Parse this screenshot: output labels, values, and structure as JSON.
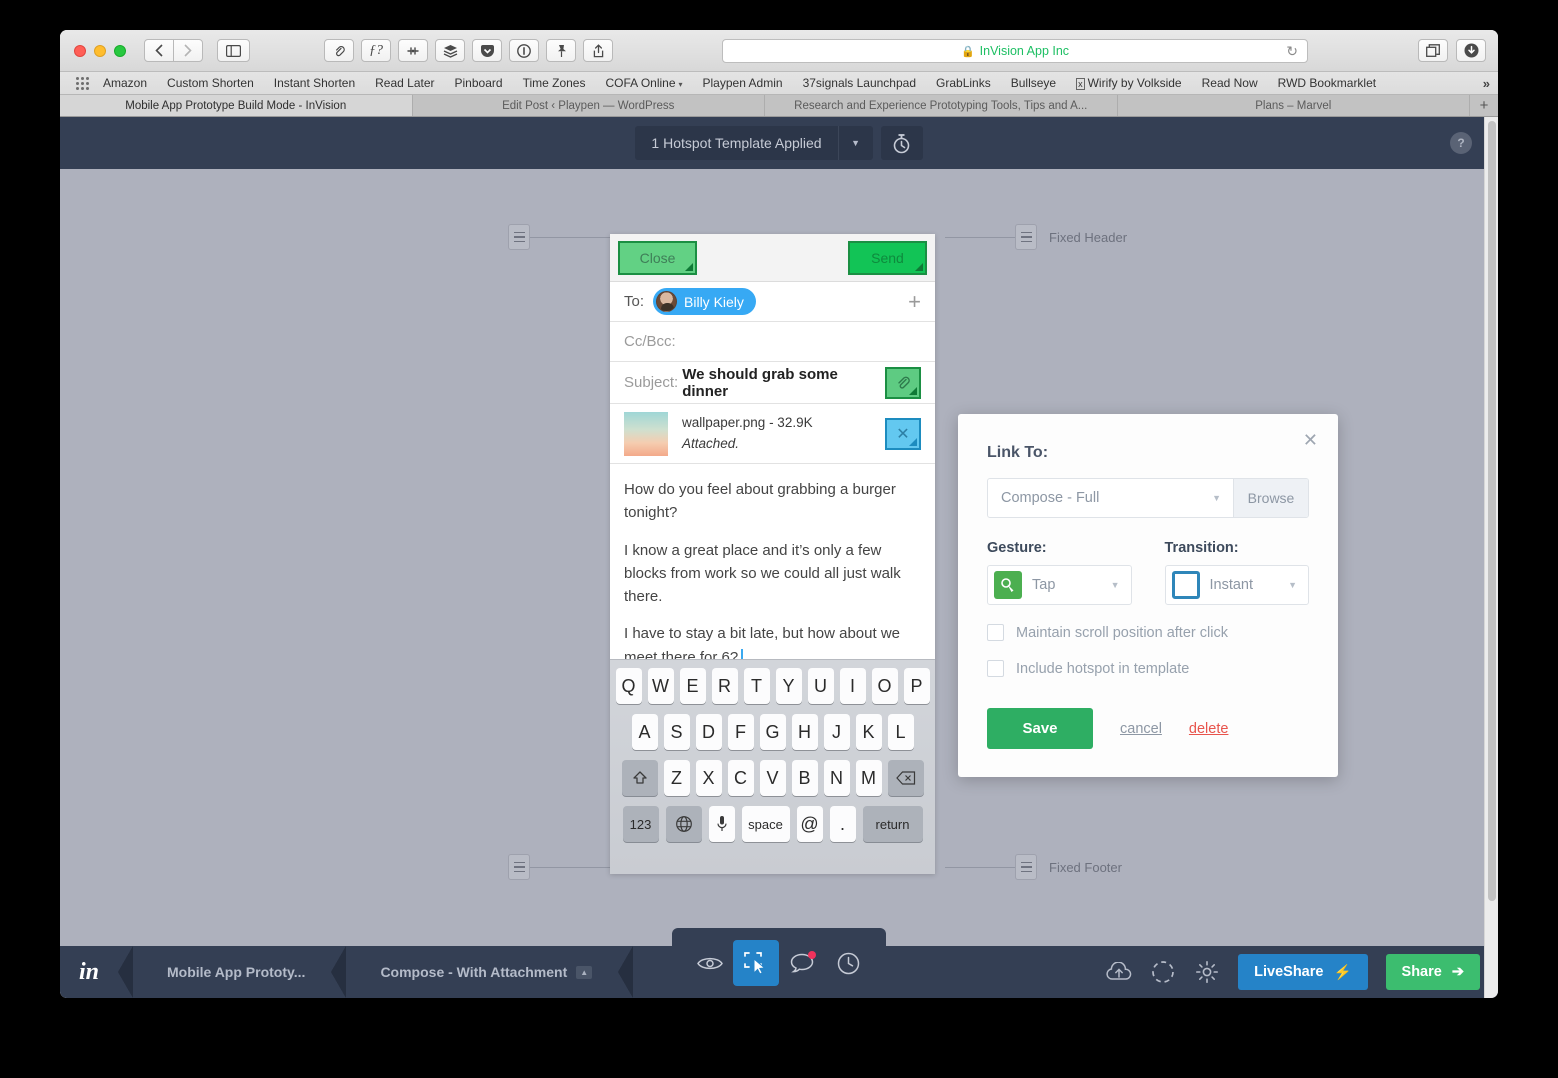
{
  "browser": {
    "url": {
      "site": "InVision App Inc",
      "lock": "lock-icon",
      "reload": "↻"
    },
    "toolbar_icons": [
      "link-icon",
      "function-icon",
      "sparkle-icon",
      "layers-icon",
      "pocket-icon",
      "instapaper-icon",
      "pin-icon",
      "share-icon"
    ],
    "right_icons": [
      "tabs-overview-icon",
      "downloads-icon"
    ],
    "nav": {
      "back": "‹",
      "forward": "›",
      "sidebar": "▣"
    },
    "bookmarks": [
      {
        "label": "Amazon"
      },
      {
        "label": "Custom Shorten"
      },
      {
        "label": "Instant Shorten"
      },
      {
        "label": "Read Later"
      },
      {
        "label": "Pinboard"
      },
      {
        "label": "Time Zones"
      },
      {
        "label": "COFA Online",
        "caret": "▾"
      },
      {
        "label": "Playpen Admin"
      },
      {
        "label": "37signals Launchpad"
      },
      {
        "label": "GrabLinks"
      },
      {
        "label": "Bullseye"
      },
      {
        "label": "Wirify by Volkside",
        "icon": "x-box-icon"
      },
      {
        "label": "Read Now"
      },
      {
        "label": "RWD Bookmarklet"
      }
    ],
    "bookmarks_more": "»",
    "tabs": [
      {
        "label": "Mobile App Prototype Build Mode - InVision",
        "active": true
      },
      {
        "label": "Edit Post ‹ Playpen — WordPress",
        "active": false
      },
      {
        "label": "Research and Experience Prototyping Tools, Tips and A...",
        "active": false
      },
      {
        "label": "Plans – Marvel",
        "active": false
      }
    ],
    "tab_add": "+"
  },
  "app": {
    "top": {
      "hotspot_template_label": "1 Hotspot Template Applied",
      "dropdown_caret": "▼",
      "timer_icon": "stopwatch-icon",
      "help_label": "?"
    },
    "canvas": {
      "fixed_header_label": "Fixed Header",
      "fixed_footer_label": "Fixed Footer"
    },
    "bottom": {
      "logo": "in",
      "breadcrumb": [
        {
          "label": "Mobile App Prototy..."
        },
        {
          "label": "Compose - With Attachment",
          "badge": "▲"
        }
      ],
      "tools": [
        {
          "name": "preview-icon",
          "active": false,
          "badge": false
        },
        {
          "name": "build-hotspot-icon",
          "active": true,
          "badge": false
        },
        {
          "name": "comment-icon",
          "active": false,
          "badge": true
        },
        {
          "name": "history-icon",
          "active": false,
          "badge": false
        }
      ],
      "right_icons": [
        "upload-cloud-icon",
        "sync-circle-icon",
        "gear-icon"
      ],
      "liveshare_label": "LiveShare",
      "liveshare_icon": "⚡",
      "share_label": "Share",
      "share_icon": "➔"
    }
  },
  "screen": {
    "header": {
      "close_label": "Close",
      "send_label": "Send"
    },
    "to": {
      "label": "To:",
      "recipient": "Billy Kiely",
      "add": "+"
    },
    "cc": {
      "label": "Cc/Bcc:"
    },
    "subject": {
      "label": "Subject:",
      "value": "We should grab some dinner",
      "clip_icon": "paperclip-icon"
    },
    "attachment": {
      "name": "wallpaper.png - 32.9K",
      "status": "Attached.",
      "remove_icon": "✕"
    },
    "body": [
      "How do you feel about grabbing a burger tonight?",
      "I know a great place and it’s only a few blocks from work so we could all just walk there.",
      "I have to stay a bit late, but how about we meet there for 6?"
    ],
    "keyboard": {
      "row1": [
        "Q",
        "W",
        "E",
        "R",
        "T",
        "Y",
        "U",
        "I",
        "O",
        "P"
      ],
      "row2": [
        "A",
        "S",
        "D",
        "F",
        "G",
        "H",
        "J",
        "K",
        "L"
      ],
      "shift": "⇧",
      "row3": [
        "Z",
        "X",
        "C",
        "V",
        "B",
        "N",
        "M"
      ],
      "backspace": "⌫",
      "numbers": "123",
      "globe": "⊕",
      "mic": "🎤",
      "space": "space",
      "at": "@",
      "period": ".",
      "return": "return"
    }
  },
  "link_panel": {
    "close": "✕",
    "title": "Link To:",
    "target_value": "Compose - Full",
    "browse_label": "Browse",
    "gesture_label": "Gesture:",
    "gesture_value": "Tap",
    "gesture_icon": "tap-icon",
    "transition_label": "Transition:",
    "transition_value": "Instant",
    "transition_icon": "instant-square-icon",
    "checkbox_scroll": "Maintain scroll position after click",
    "checkbox_template": "Include hotspot in template",
    "save_label": "Save",
    "cancel_label": "cancel",
    "delete_label": "delete",
    "colors": {
      "save": "#2eae63",
      "delete": "#e8544c",
      "accent_blue": "#2583c8"
    }
  }
}
